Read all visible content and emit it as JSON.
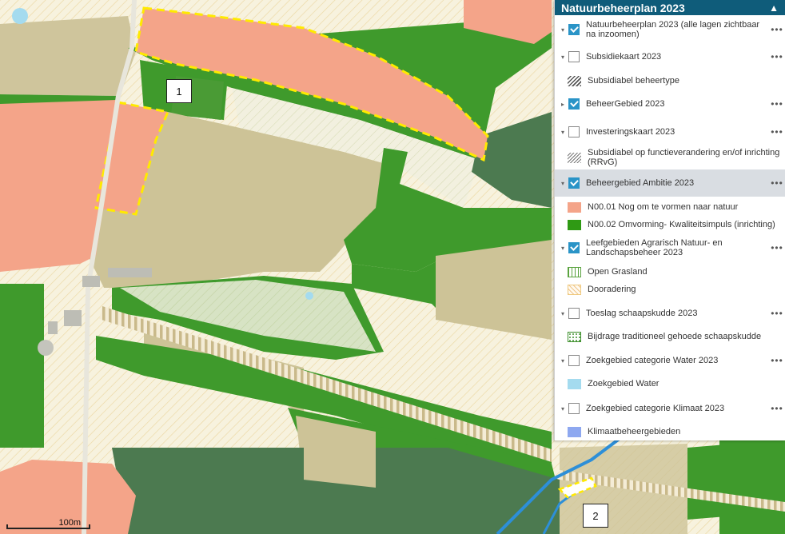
{
  "map": {
    "callouts": [
      "1",
      "2"
    ],
    "scale_label": "100m"
  },
  "legend": {
    "title": "Natuurbeheerplan 2023",
    "colors": {
      "header": "#0f5c7a",
      "checkbox_on": "#2a94c7",
      "salmon": "#f4a489",
      "green": "#2f9a14",
      "water": "#a4dbef",
      "climate": "#8ea8f0"
    },
    "layers": [
      {
        "label": "Natuurbeheerplan 2023 (alle lagen zichtbaar na inzoomen)",
        "checked": true,
        "expand": "down"
      },
      {
        "label": "Subsidiekaart 2023",
        "checked": false,
        "expand": "down"
      },
      {
        "sublabel": "Subsidiabel beheertype",
        "swatch": "hatch"
      },
      {
        "label": "BeheerGebied 2023",
        "checked": true,
        "expand": "right"
      },
      {
        "label": "Investeringskaart 2023",
        "checked": false,
        "expand": "down"
      },
      {
        "sublabel": "Subsidiabel op functieverandering en/of inrichting (RRvG)",
        "swatch": "hatch2"
      },
      {
        "label": "Beheergebied Ambitie 2023",
        "checked": true,
        "expand": "down",
        "selected": true
      },
      {
        "sublabel": "N00.01 Nog om te vormen naar natuur",
        "swatch": "salmon"
      },
      {
        "sublabel": "N00.02 Omvorming- Kwaliteitsimpuls (inrichting)",
        "swatch": "green"
      },
      {
        "label": "Leefgebieden Agrarisch Natuur- en Landschapsbeheer 2023",
        "checked": true,
        "expand": "down"
      },
      {
        "sublabel": "Open Grasland",
        "swatch": "vert"
      },
      {
        "sublabel": "Dooradering",
        "swatch": "diag"
      },
      {
        "label": "Toeslag schaapskudde 2023",
        "checked": false,
        "expand": "down"
      },
      {
        "sublabel": "Bijdrage traditioneel gehoede schaapskudde",
        "swatch": "dots"
      },
      {
        "label": "Zoekgebied categorie Water 2023",
        "checked": false,
        "expand": "down"
      },
      {
        "sublabel": "Zoekgebied Water",
        "swatch": "water"
      },
      {
        "label": "Zoekgebied categorie Klimaat 2023",
        "checked": false,
        "expand": "down"
      },
      {
        "sublabel": "Klimaatbeheergebieden",
        "swatch": "climate"
      }
    ]
  }
}
